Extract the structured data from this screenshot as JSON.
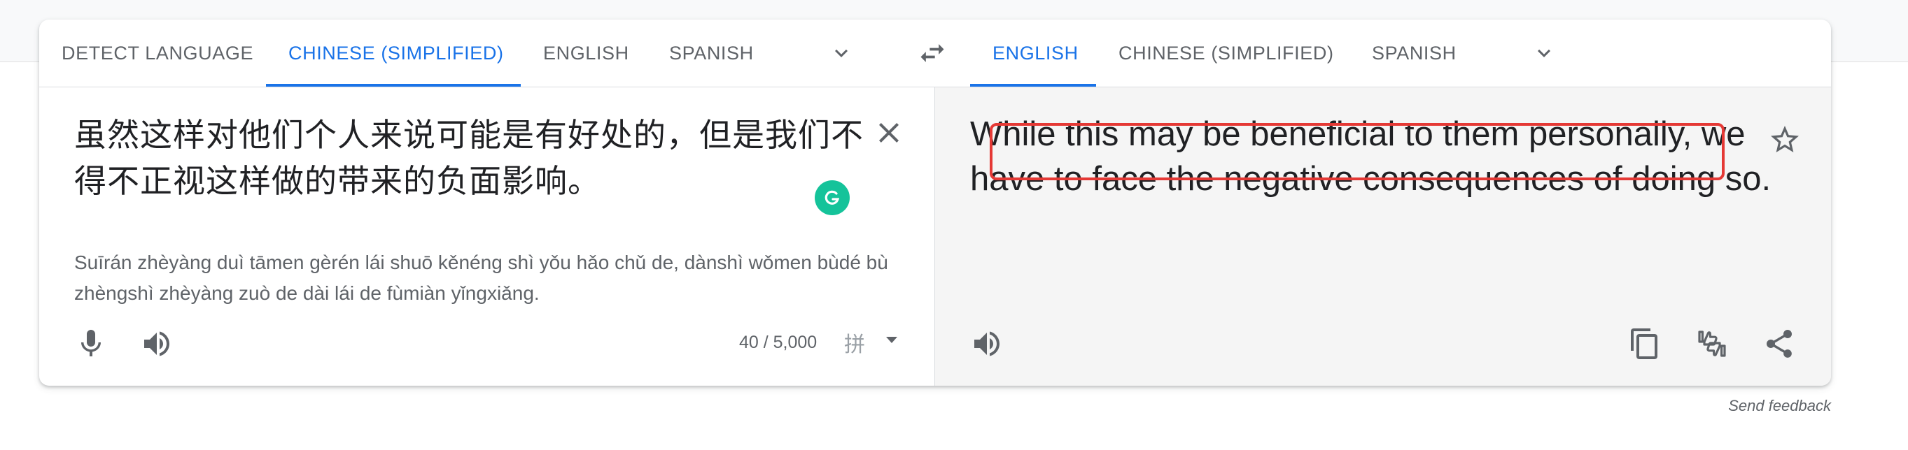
{
  "source_tabs": [
    {
      "label": "DETECT LANGUAGE",
      "active": false
    },
    {
      "label": "CHINESE (SIMPLIFIED)",
      "active": true
    },
    {
      "label": "ENGLISH",
      "active": false
    },
    {
      "label": "SPANISH",
      "active": false
    }
  ],
  "target_tabs": [
    {
      "label": "ENGLISH",
      "active": true
    },
    {
      "label": "CHINESE (SIMPLIFIED)",
      "active": false
    },
    {
      "label": "SPANISH",
      "active": false
    }
  ],
  "source": {
    "text": "虽然这样对他们个人来说可能是有好处的，但是我们不得不正视这样做的带来的负面影响。",
    "transliteration": "Suīrán zhèyàng duì tāmen gèrén lái shuō kěnéng shì yǒu hǎo chǔ de, dànshì wǒmen bùdé bù zhèngshì zhèyàng zuò de dài lái de fùmiàn yǐngxiǎng.",
    "char_count": "40 / 5,000",
    "ime_label": "拼"
  },
  "target": {
    "text": "While this may be beneficial to them personally, we have to face the negative consequences of doing so."
  },
  "footer": {
    "send_feedback": "Send feedback"
  },
  "icons": {
    "swap": "swap-languages-icon",
    "clear": "close-icon",
    "mic": "microphone-icon",
    "speaker": "speaker-icon",
    "star": "star-icon",
    "copy": "copy-icon",
    "rate": "thumbs-rate-icon",
    "share": "share-icon",
    "grammarly": "grammarly-icon"
  },
  "colors": {
    "accent": "#1a73e8",
    "highlight_box": "#e53935",
    "grammarly": "#15c39a"
  }
}
